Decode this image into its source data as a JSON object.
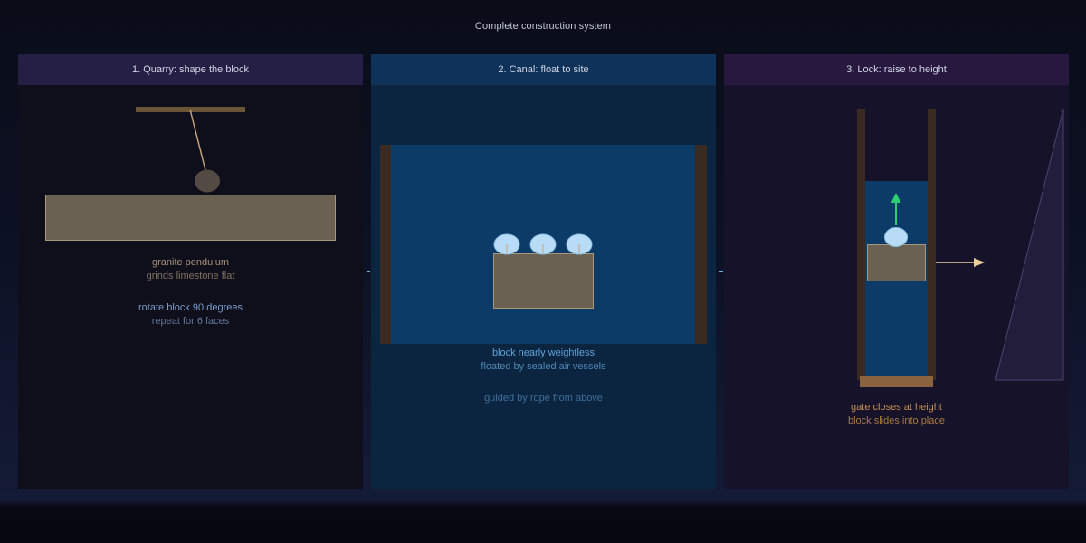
{
  "page_title": "Complete construction system",
  "panels": [
    {
      "id": "quarry",
      "header": "1. Quarry: shape the block",
      "captions": [
        {
          "text": "granite pendulum",
          "color": "#a89379"
        },
        {
          "text": "grinds limestone flat",
          "color": "#807260"
        },
        {
          "text": "rotate block 90 degrees",
          "color": "#7b9fcf"
        },
        {
          "text": "repeat for 6 faces",
          "color": "#61799c"
        }
      ]
    },
    {
      "id": "canal",
      "header": "2. Canal: float to site",
      "captions": [
        {
          "text": "block nearly weightless",
          "color": "#5fa3d9"
        },
        {
          "text": "floated by sealed air vessels",
          "color": "#4f88b5"
        },
        {
          "text": "guided by rope from above",
          "color": "#3f6f99"
        }
      ]
    },
    {
      "id": "lock",
      "header": "3. Lock: raise to height",
      "captions": [
        {
          "text": "gate closes at height",
          "color": "#c58f4f"
        },
        {
          "text": "block slides into place",
          "color": "#a8793f"
        }
      ]
    }
  ],
  "colors": {
    "stone": "#6b6152",
    "stone_outline": "#a8977a",
    "wood": "#3a2b22",
    "water": "#0d3b68",
    "air_vessel": "#b8dcf5",
    "rise_arrow": "#2ecc71",
    "slide_arrow": "#e8cf9a",
    "pendulum_bob": "#544a44"
  }
}
